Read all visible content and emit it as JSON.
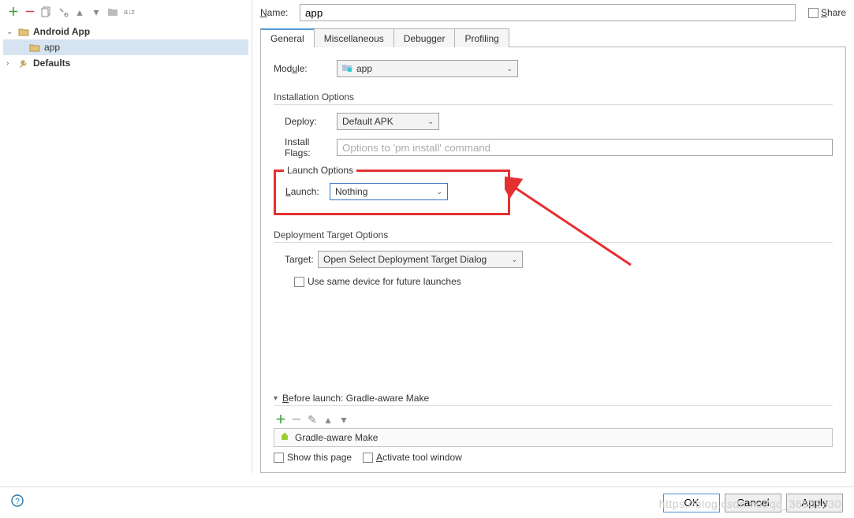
{
  "toolbar": {
    "plus": "＋",
    "minus": "－"
  },
  "tree": {
    "androidApp": "Android App",
    "app": "app",
    "defaults": "Defaults"
  },
  "name": {
    "label": "Name:",
    "value": "app",
    "share": "Share"
  },
  "tabs": {
    "general": "General",
    "misc": "Miscellaneous",
    "debugger": "Debugger",
    "profiling": "Profiling"
  },
  "module": {
    "label": "Module:",
    "value": "app"
  },
  "install": {
    "title": "Installation Options",
    "deployLabel": "Deploy:",
    "deployValue": "Default APK",
    "flagsLabel": "Install Flags:",
    "flagsPlaceholder": "Options to 'pm install' command"
  },
  "launch": {
    "title": "Launch Options",
    "label": "Launch:",
    "value": "Nothing"
  },
  "deploy": {
    "title": "Deployment Target Options",
    "targetLabel": "Target:",
    "targetValue": "Open Select Deployment Target Dialog",
    "sameDevice": "Use same device for future launches"
  },
  "before": {
    "title": "Before launch: Gradle-aware Make",
    "item": "Gradle-aware Make",
    "showPage": "Show this page",
    "activateWin": "Activate tool window"
  },
  "footer": {
    "ok": "OK",
    "cancel": "Cancel",
    "apply": "Apply"
  },
  "watermark": "https://blog.csdn.net/qq_36982930"
}
